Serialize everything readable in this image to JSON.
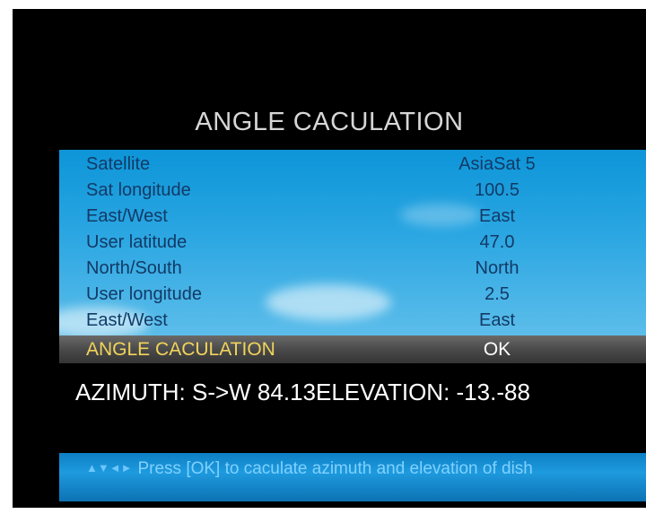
{
  "title": "ANGLE CACULATION",
  "settings": [
    {
      "label": "Satellite",
      "value": "AsiaSat 5"
    },
    {
      "label": "Sat longitude",
      "value": "100.5"
    },
    {
      "label": "East/West",
      "value": "East"
    },
    {
      "label": "User latitude",
      "value": "47.0"
    },
    {
      "label": "North/South",
      "value": "North"
    },
    {
      "label": "User longitude",
      "value": "2.5"
    },
    {
      "label": "East/West",
      "value": "East"
    }
  ],
  "selected_row": {
    "label": "ANGLE CACULATION",
    "value": "OK"
  },
  "result": "AZIMUTH: S->W 84.13ELEVATION: -13.-88",
  "help": {
    "icon": "arrow-keys-icon",
    "text": "Press [OK] to caculate azimuth and elevation of dish"
  },
  "colors": {
    "panel": "#2aa6e2",
    "selected_label": "#f1d35a",
    "help_text": "#7fd1ff"
  }
}
